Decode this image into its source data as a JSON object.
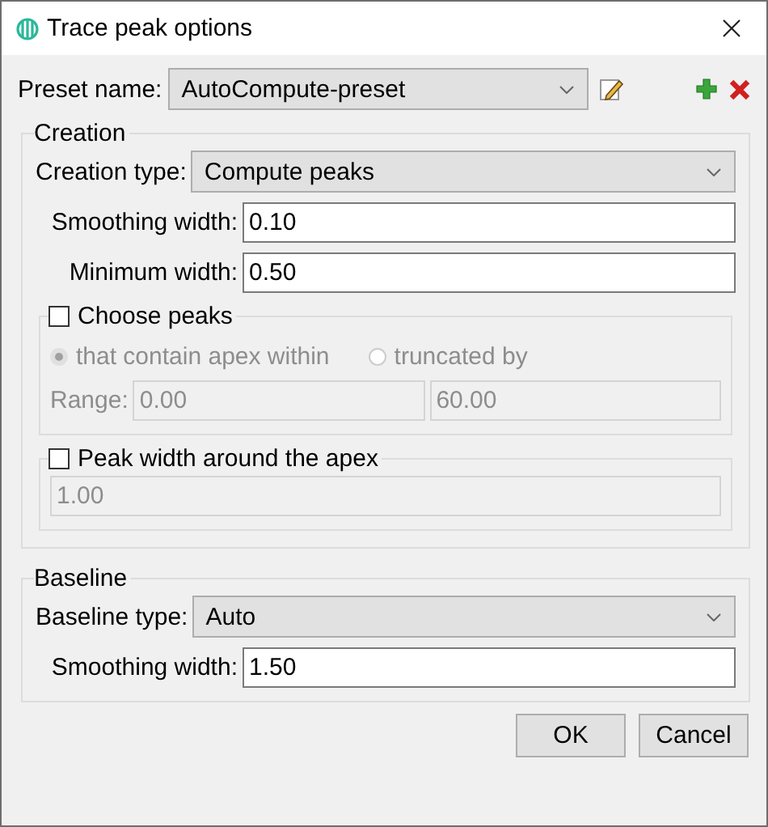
{
  "window": {
    "title": "Trace peak options"
  },
  "preset": {
    "label": "Preset name:",
    "value": "AutoCompute-preset"
  },
  "creation": {
    "title": "Creation",
    "fields": [
      {
        "kind": "select",
        "label": "Creation type:",
        "value": "Compute peaks"
      },
      {
        "kind": "text",
        "label": "Smoothing width:",
        "value": "0.10"
      },
      {
        "kind": "text",
        "label": "Minimum width:",
        "value": "0.50"
      }
    ],
    "choose_peaks": {
      "label": "Choose peaks",
      "checked": false,
      "options": [
        {
          "label": "that contain apex within",
          "selected": true
        },
        {
          "label": "truncated by",
          "selected": false
        }
      ],
      "range_label": "Range:",
      "range_from": "0.00",
      "range_to": "60.00"
    },
    "peak_width": {
      "label": "Peak width around the apex",
      "checked": false,
      "value": "1.00"
    }
  },
  "baseline": {
    "title": "Baseline",
    "fields": [
      {
        "kind": "select",
        "label": "Baseline type:",
        "value": "Auto"
      },
      {
        "kind": "text",
        "label": "Smoothing width:",
        "value": "1.50"
      }
    ]
  },
  "buttons": [
    {
      "label": "OK"
    },
    {
      "label": "Cancel"
    }
  ]
}
